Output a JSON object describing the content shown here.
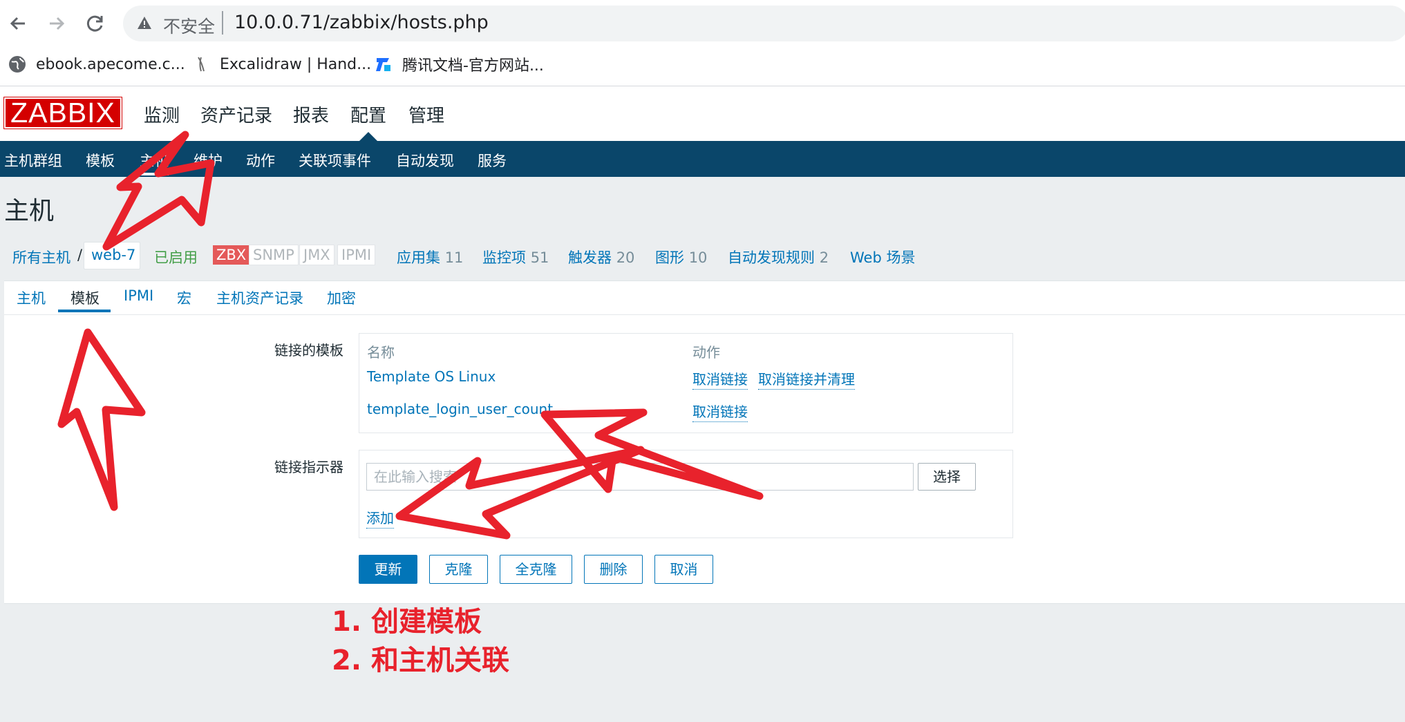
{
  "browser": {
    "security_label": "不安全",
    "url": "10.0.0.71/zabbix/hosts.php",
    "bookmarks": [
      {
        "label": "ebook.apecome.c...",
        "icon": "globe-icon"
      },
      {
        "label": "Excalidraw | Hand...",
        "icon": "excalidraw-icon"
      },
      {
        "label": "腾讯文档-官方网站...",
        "icon": "tencent-docs-icon"
      }
    ]
  },
  "zabbix": {
    "logo": "ZABBIX",
    "main_menu": [
      "监测",
      "资产记录",
      "报表",
      "配置",
      "管理"
    ],
    "sub_menu": [
      "主机群组",
      "模板",
      "主机",
      "维护",
      "动作",
      "关联项事件",
      "自动发现",
      "服务"
    ],
    "page_title": "主机"
  },
  "host_nav": {
    "all_hosts": "所有主机",
    "separator": "/",
    "host": "web-7",
    "status": "已启用",
    "tags": [
      "ZBX",
      "SNMP",
      "JMX",
      "IPMI"
    ],
    "links": [
      {
        "label": "应用集",
        "count": "11"
      },
      {
        "label": "监控项",
        "count": "51"
      },
      {
        "label": "触发器",
        "count": "20"
      },
      {
        "label": "图形",
        "count": "10"
      },
      {
        "label": "自动发现规则",
        "count": "2"
      },
      {
        "label": "Web 场景",
        "count": ""
      }
    ]
  },
  "tabs": [
    "主机",
    "模板",
    "IPMI",
    "宏",
    "主机资产记录",
    "加密"
  ],
  "form": {
    "linked_templates_label": "链接的模板",
    "col_name": "名称",
    "col_action": "动作",
    "templates": [
      {
        "name": "Template OS Linux",
        "actions": [
          "取消链接",
          "取消链接并清理"
        ]
      },
      {
        "name": "template_login_user_count",
        "actions": [
          "取消链接"
        ]
      }
    ],
    "link_indicator_label": "链接指示器",
    "search_placeholder": "在此输入搜索",
    "select_button": "选择",
    "add_link": "添加",
    "buttons": {
      "update": "更新",
      "clone": "克隆",
      "full_clone": "全克隆",
      "delete": "删除",
      "cancel": "取消"
    }
  },
  "annotation": {
    "line1": "1. 创建模板",
    "line2": "2. 和主机关联",
    "color": "#e8222c"
  }
}
